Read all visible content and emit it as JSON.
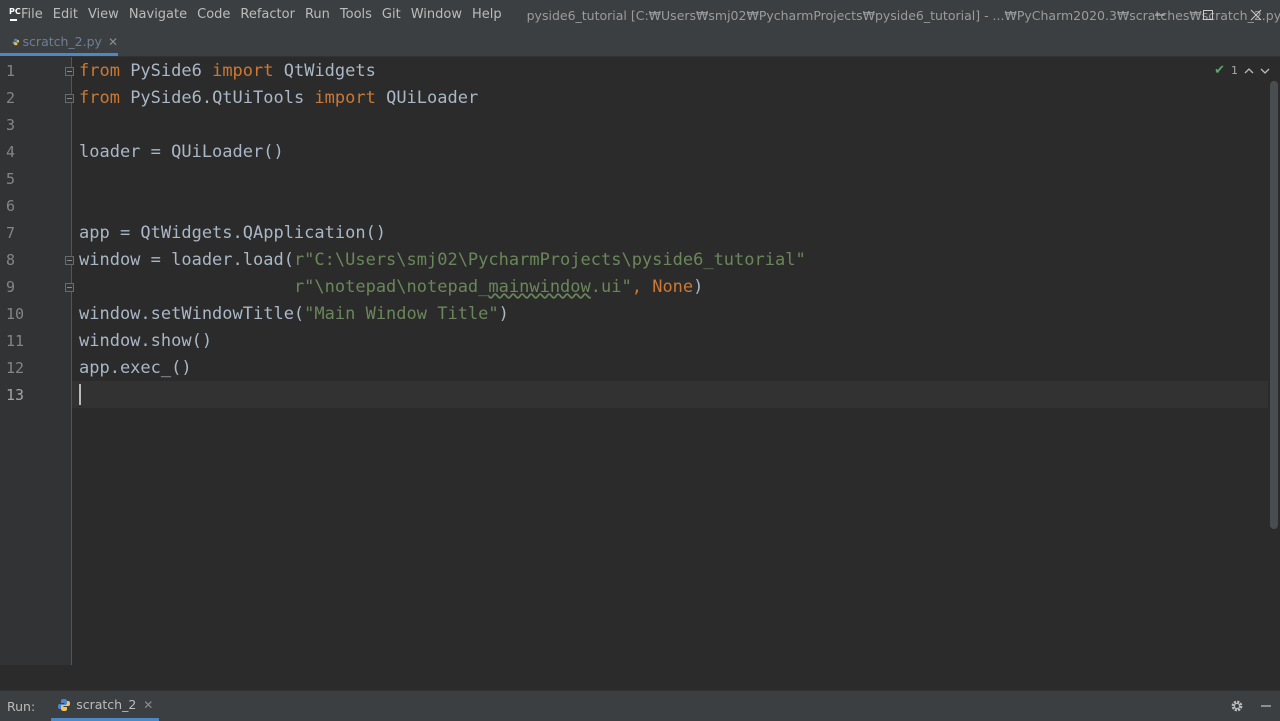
{
  "titlebar": {
    "menu": [
      "File",
      "Edit",
      "View",
      "Navigate",
      "Code",
      "Refactor",
      "Run",
      "Tools",
      "Git",
      "Window",
      "Help"
    ],
    "title": "pyside6_tutorial [C:₩Users₩smj02₩PycharmProjects₩pyside6_tutorial] - ...₩PyCharm2020.3₩scratches₩scratch_2.py",
    "logo": "PC"
  },
  "tab": {
    "label": "scratch_2.py",
    "close": "✕",
    "icon": "python-file-icon"
  },
  "editor": {
    "line_numbers": [
      "1",
      "2",
      "3",
      "4",
      "5",
      "6",
      "7",
      "8",
      "9",
      "10",
      "11",
      "12",
      "13"
    ],
    "inspection_count": "1",
    "lines": {
      "l1_a": "from",
      "l1_b": " PySide6 ",
      "l1_c": "import",
      "l1_d": " QtWidgets",
      "l2_a": "from",
      "l2_b": " PySide6.QtUiTools ",
      "l2_c": "import",
      "l2_d": " QUiLoader",
      "l4": "loader = QUiLoader()",
      "l7": "app = QtWidgets.QApplication()",
      "l8_a": "window = loader.load(",
      "l8_b": "r\"C:\\Users\\smj02\\PycharmProjects\\pyside6_tutorial\"",
      "l9_a": "                     ",
      "l9_b": "r\"\\notepad\\notepad_",
      "l9_c": "mainwindow",
      "l9_d": ".ui\"",
      "l9_e": ", ",
      "l9_f": "None",
      "l9_g": ")",
      "l10_a": "window.setWindowTitle(",
      "l10_b": "\"Main Window Title\"",
      "l10_c": ")",
      "l11": "window.show()",
      "l12": "app.exec_()"
    }
  },
  "runbar": {
    "label": "Run:",
    "tab_label": "scratch_2",
    "close": "✕"
  },
  "colors": {
    "keyword": "#cc7832",
    "string": "#6a8759",
    "text": "#a9b7c6",
    "accent": "#4a88c7"
  }
}
